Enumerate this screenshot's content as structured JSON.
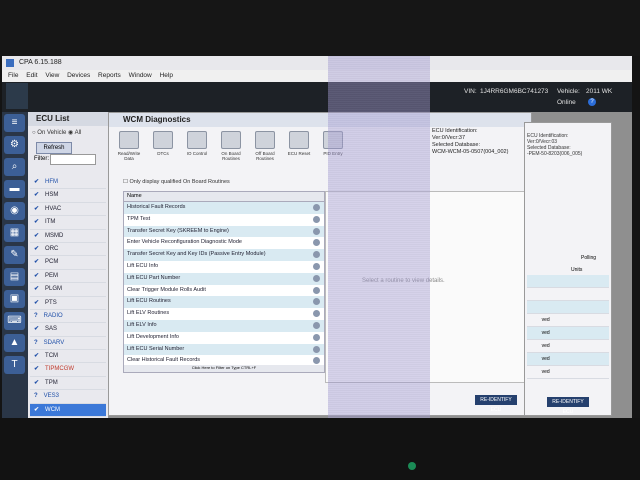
{
  "app": {
    "title": "CPA 6.15.188"
  },
  "menu": [
    "File",
    "Edit",
    "View",
    "Devices",
    "Reports",
    "Window",
    "Help"
  ],
  "infobar": {
    "vin_label": "VIN:",
    "vin_value": "1J4RR6GM6BC741273",
    "vehicle_label": "Vehicle:",
    "vehicle_value": "2011 WK",
    "online": "Online",
    "help": "?"
  },
  "ecu_list": {
    "title": "ECU List",
    "on_vehicle": "On Vehicle",
    "all": "All",
    "refresh": "Refresh",
    "filter_label": "Filter:",
    "items": [
      {
        "label": "HFM",
        "state": "blue",
        "check": "✔"
      },
      {
        "label": "HSM",
        "state": "normal",
        "check": "✔"
      },
      {
        "label": "HVAC",
        "state": "normal",
        "check": "✔"
      },
      {
        "label": "ITM",
        "state": "normal",
        "check": "✔"
      },
      {
        "label": "MSMD",
        "state": "normal",
        "check": "✔"
      },
      {
        "label": "ORC",
        "state": "normal",
        "check": "✔"
      },
      {
        "label": "PCM",
        "state": "normal",
        "check": "✔"
      },
      {
        "label": "PEM",
        "state": "normal",
        "check": "✔"
      },
      {
        "label": "PLGM",
        "state": "normal",
        "check": "✔"
      },
      {
        "label": "PTS",
        "state": "normal",
        "check": "✔"
      },
      {
        "label": "RADIO",
        "state": "blue",
        "check": "?"
      },
      {
        "label": "SAS",
        "state": "normal",
        "check": "✔"
      },
      {
        "label": "SDARV",
        "state": "blue",
        "check": "?"
      },
      {
        "label": "TCM",
        "state": "normal",
        "check": "✔"
      },
      {
        "label": "TIPMCGW",
        "state": "red",
        "check": "✔"
      },
      {
        "label": "TPM",
        "state": "normal",
        "check": "✔"
      },
      {
        "label": "VES3",
        "state": "blue",
        "check": "?"
      },
      {
        "label": "WCM",
        "state": "selected",
        "check": "✔"
      }
    ]
  },
  "wcm": {
    "title": "WCM Diagnostics",
    "tools": [
      {
        "label": "Read/Write Data"
      },
      {
        "label": "DTCs"
      },
      {
        "label": "IO Control"
      },
      {
        "label": "On Board Routines"
      },
      {
        "label": "Off Board Routines"
      },
      {
        "label": "ECU Reset"
      },
      {
        "label": "PID Entry"
      }
    ],
    "only_qualified": "Only display qualified On Board Routines",
    "name_header": "Name",
    "routines": [
      "Historical Fault Records",
      "TPM Test",
      "Transfer Secret Key (SKREEM to Engine)",
      "Enter Vehicle Reconfiguration Diagnostic Mode",
      "Transfer Secret Key and Key IDs (Passive Entry Module)",
      "Lift ECU Info",
      "Lift ECU Part Number",
      "Clear Trigger Module Rolls Audit",
      "Lift ECU Routines",
      "Lift ELV Routines",
      "Lift ELV Info",
      "Lift Development Info",
      "Lift ECU Serial Number",
      "Clear Historical Fault Records"
    ],
    "routines_footer": "Click Here to Filter on Type CTRL+F",
    "detail_msg": "Select a routine to view details.",
    "reidentify": "RE-IDENTIFY ECU"
  },
  "ecu_ident": {
    "heading": "ECU Identification:",
    "ver": "Ver:0/Vecr:37",
    "db_label": "Selected Database:",
    "db_value": "WCM-WCM-05-0507(004_002)"
  },
  "right_panel": {
    "ident_heading": "ECU Identification:",
    "ver": "Ver:0/Vecr:03",
    "db_label": "Selected Database:",
    "db_value": "-PEM-50-8203(006_005)",
    "polling": "Polling",
    "units": "Units",
    "rows": [
      "",
      "",
      "",
      "ved",
      "ved",
      "ved",
      "ved",
      "ved"
    ],
    "reidentify": "RE-IDENTIFY ECU"
  }
}
